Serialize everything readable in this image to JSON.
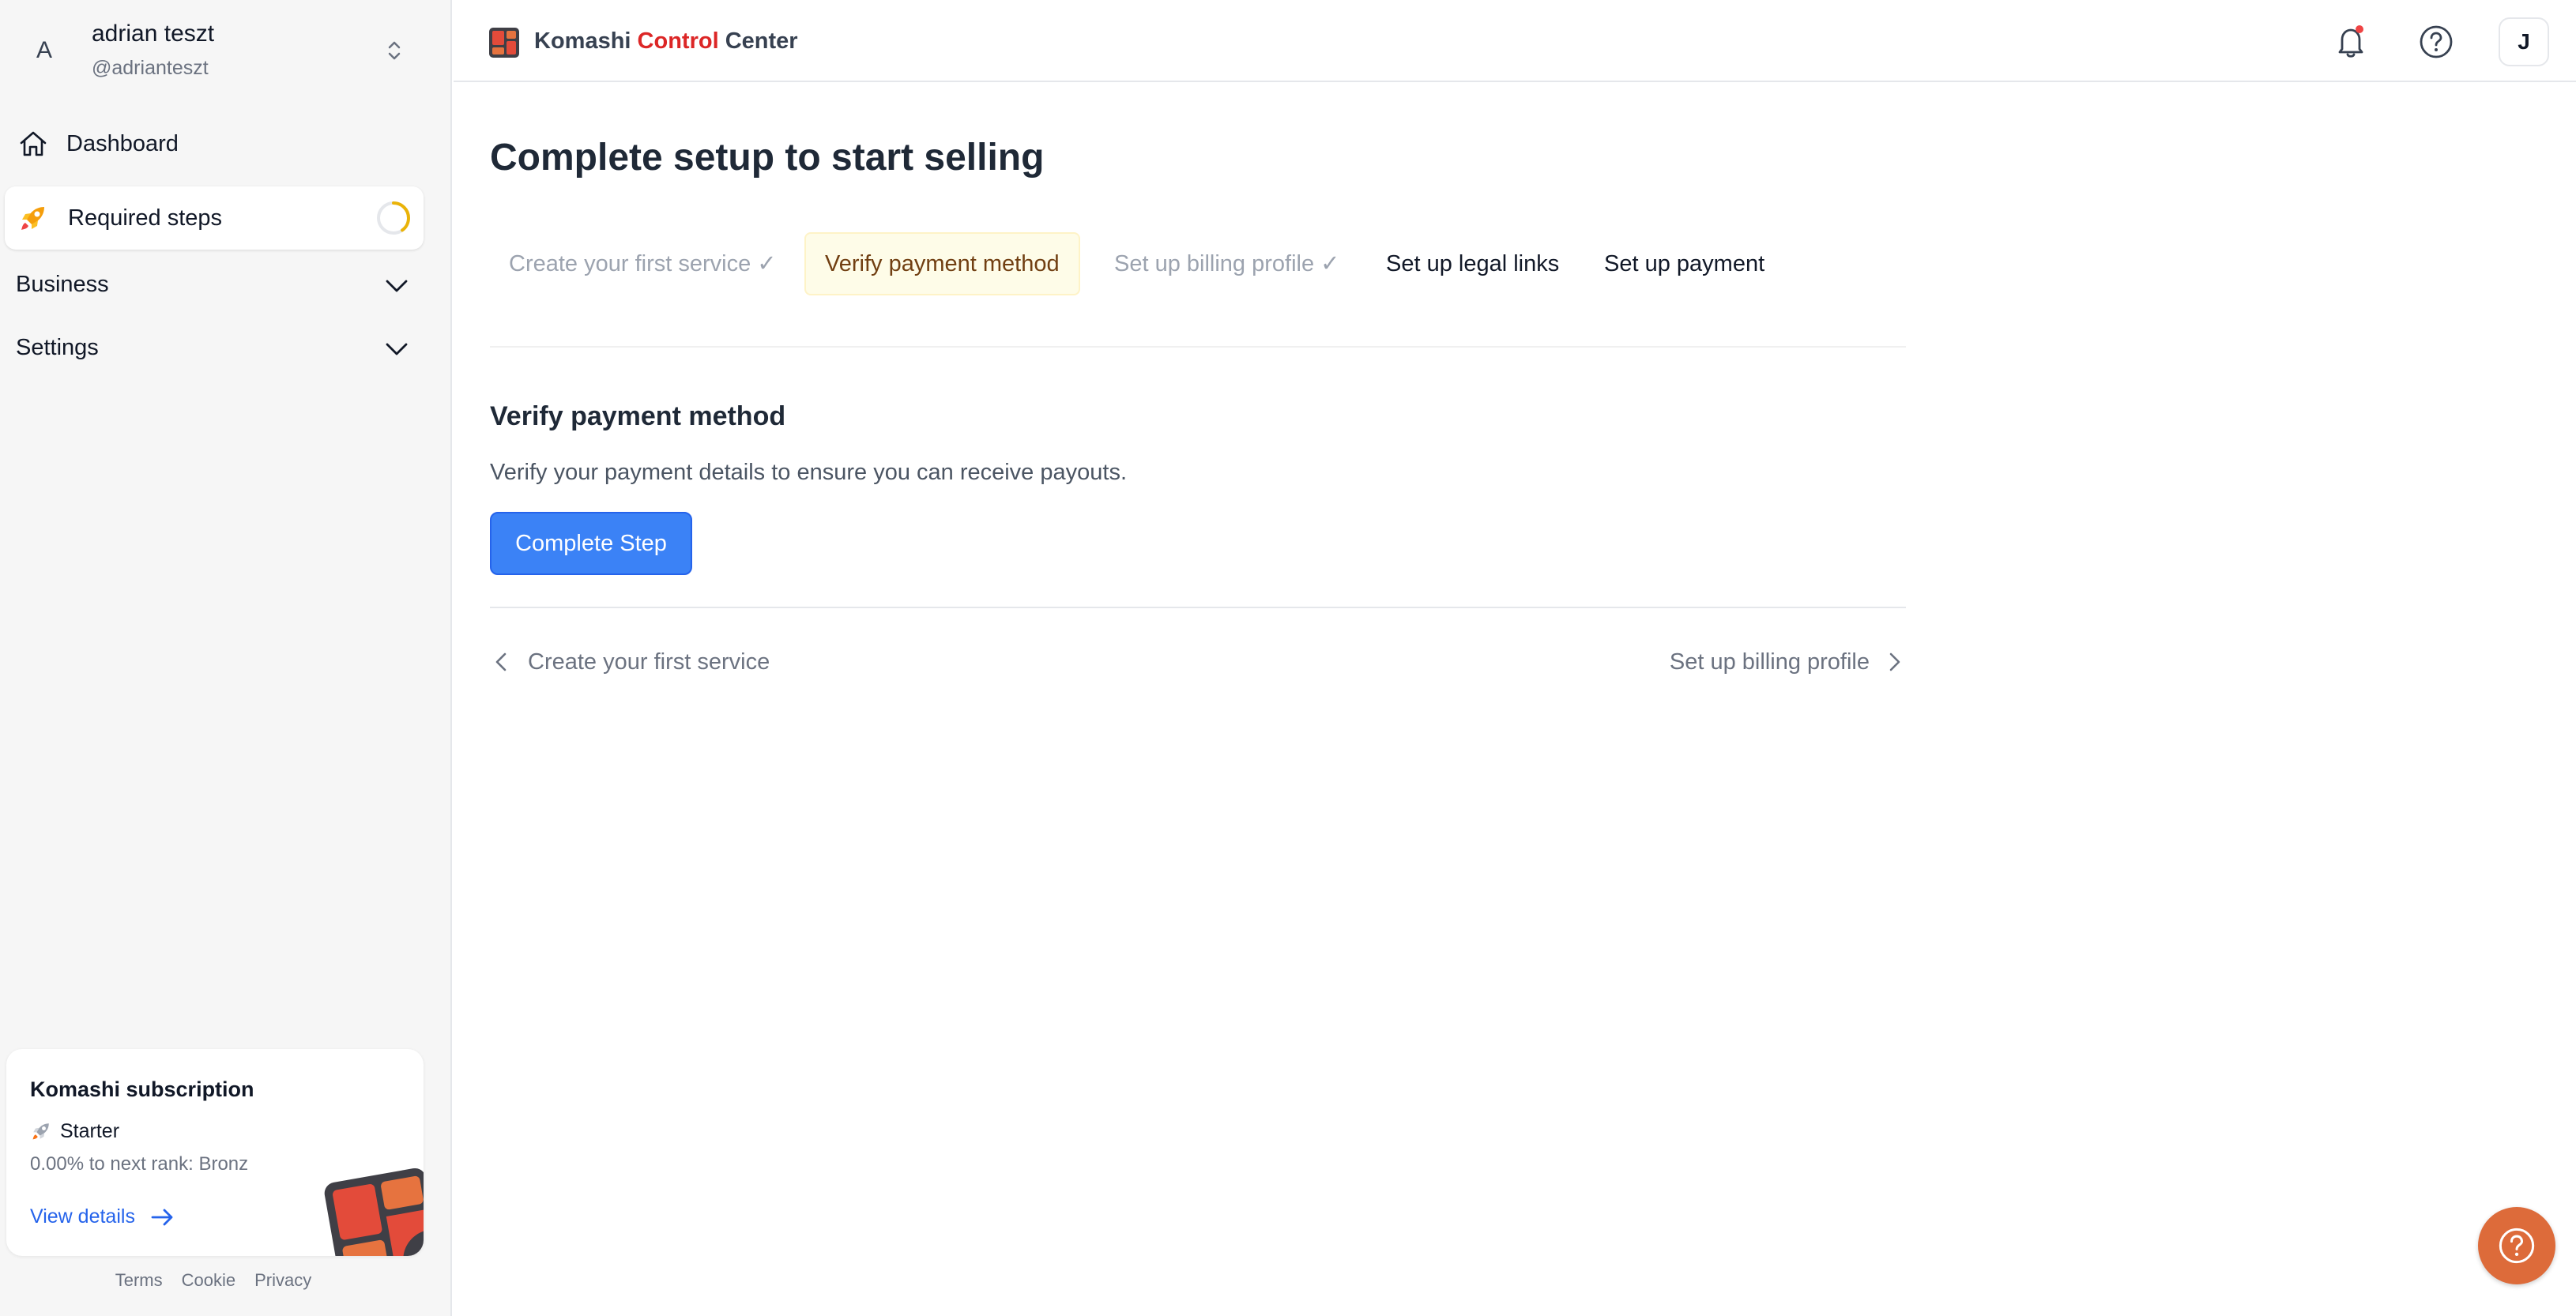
{
  "account": {
    "avatar_letter": "A",
    "name": "adrian teszt",
    "handle": "@adrianteszt"
  },
  "sidebar": {
    "dashboard": "Dashboard",
    "required_steps": "Required steps",
    "required_steps_progress": 0.4,
    "business": "Business",
    "settings": "Settings"
  },
  "subscription": {
    "title": "Komashi subscription",
    "plan": "Starter",
    "progress_text": "0.00% to next rank: Bronz",
    "link": "View details"
  },
  "footer": {
    "terms": "Terms",
    "cookie": "Cookie",
    "privacy": "Privacy"
  },
  "topbar": {
    "brand_part1": "Komashi",
    "brand_part2": "Control",
    "brand_part3": "Center",
    "user_initial": "J"
  },
  "main": {
    "title": "Complete setup to start selling",
    "steps": [
      {
        "label": "Create your first service",
        "check": "✓",
        "state": "done"
      },
      {
        "label": "Verify payment method",
        "state": "active"
      },
      {
        "label": "Set up billing profile",
        "check": "✓",
        "state": "done"
      },
      {
        "label": "Set up legal links",
        "state": "todo"
      },
      {
        "label": "Set up payment",
        "state": "todo"
      }
    ],
    "section_title": "Verify payment method",
    "section_desc": "Verify your payment details to ensure you can receive payouts.",
    "complete_button": "Complete Step",
    "prev_link": "Create your first service",
    "next_link": "Set up billing profile"
  },
  "colors": {
    "accent": "#3b82f6",
    "brand_red": "#dc2626",
    "fab": "#dd6b3a",
    "active_step_bg": "#fefce8"
  }
}
